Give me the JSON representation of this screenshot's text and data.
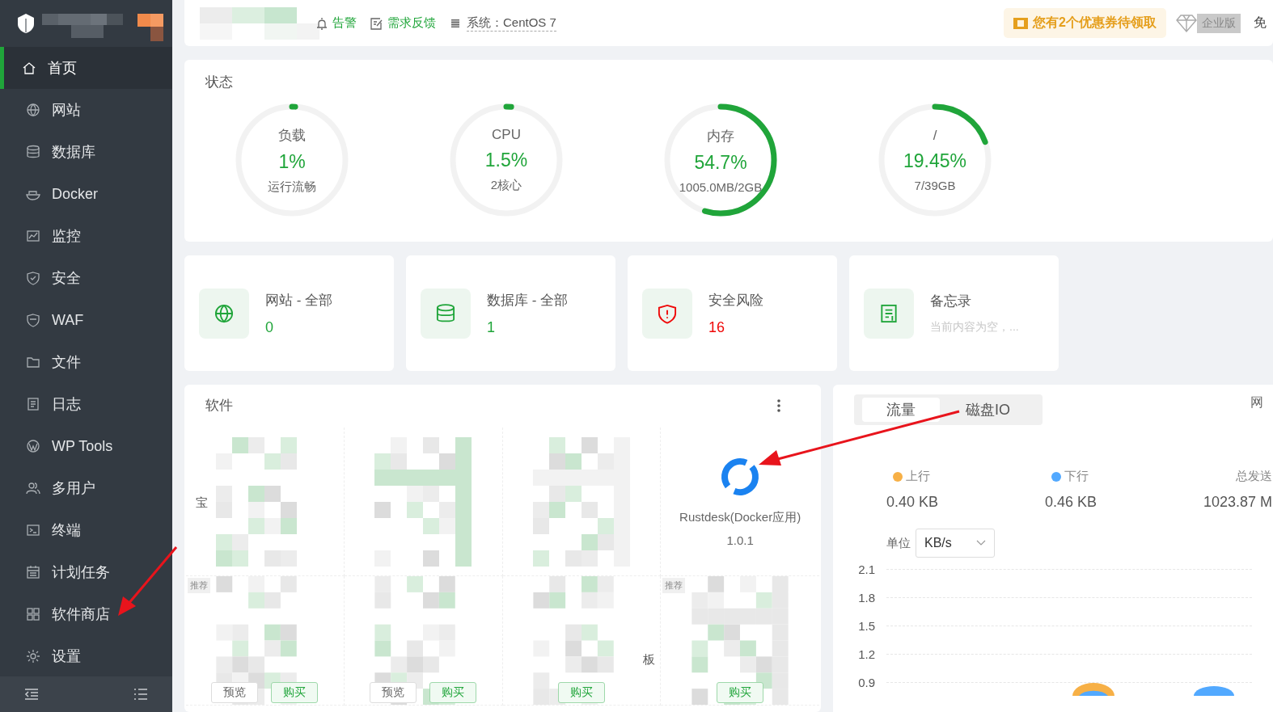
{
  "sidebar": {
    "items": [
      {
        "label": "首页",
        "selected": true
      },
      {
        "label": "网站",
        "selected": false
      },
      {
        "label": "数据库",
        "selected": false
      },
      {
        "label": "Docker",
        "selected": false
      },
      {
        "label": "监控",
        "selected": false
      },
      {
        "label": "安全",
        "selected": false
      },
      {
        "label": "WAF",
        "selected": false
      },
      {
        "label": "文件",
        "selected": false
      },
      {
        "label": "日志",
        "selected": false
      },
      {
        "label": "WP Tools",
        "selected": false
      },
      {
        "label": "多用户",
        "selected": false
      },
      {
        "label": "终端",
        "selected": false
      },
      {
        "label": "计划任务",
        "selected": false
      },
      {
        "label": "软件商店",
        "selected": false
      },
      {
        "label": "设置",
        "selected": false
      }
    ]
  },
  "topbar": {
    "links": [
      {
        "kind": "alert",
        "label": "告警"
      },
      {
        "kind": "feedback",
        "label": "需求反馈"
      },
      {
        "kind": "system",
        "label": "系统：CentOS 7"
      }
    ],
    "coupon": "您有2个优惠券待领取",
    "edition": "企业版",
    "trailing": "免"
  },
  "status": {
    "title": "状态",
    "gauges": [
      {
        "label": "负载",
        "value": "1%",
        "detail": "运行流畅",
        "level": 0.01
      },
      {
        "label": "CPU",
        "value": "1.5%",
        "detail": "2核心",
        "level": 0.015
      },
      {
        "label": "内存",
        "value": "54.7%",
        "detail": "1005.0MB/2GB",
        "level": 0.547
      },
      {
        "label": "/",
        "value": "19.45%",
        "detail": "7/39GB",
        "level": 0.1945
      }
    ]
  },
  "overview": [
    {
      "label": "网站 - 全部",
      "value": "0",
      "kind": "count"
    },
    {
      "label": "数据库 - 全部",
      "value": "1",
      "kind": "count"
    },
    {
      "label": "安全风险",
      "value": "16",
      "kind": "alert"
    },
    {
      "label": "备忘录",
      "value": "当前内容为空，...",
      "kind": "note"
    }
  ],
  "software": {
    "title": "软件",
    "items": [
      {
        "kind": "hidden",
        "fragment": "宝"
      },
      {
        "kind": "hidden"
      },
      {
        "kind": "hidden"
      },
      {
        "kind": "app",
        "name": "Rustdesk(Docker应用)",
        "version": "1.0.1"
      },
      {
        "kind": "hidden",
        "tag": "推荐",
        "buttons": [
          "预览",
          "购买"
        ]
      },
      {
        "kind": "hidden",
        "buttons": [
          "预览",
          "购买"
        ]
      },
      {
        "kind": "hidden",
        "fragment": "板",
        "buttons": [
          "购买"
        ]
      },
      {
        "kind": "hidden",
        "tag": "推荐",
        "buttons": [
          "购买"
        ]
      }
    ]
  },
  "traffic": {
    "tabs": [
      {
        "label": "流量",
        "selected": true
      },
      {
        "label": "磁盘IO",
        "selected": false
      }
    ],
    "trailing": "网",
    "stats": [
      {
        "label": "上行",
        "value": "0.40 KB",
        "color": "#f7b046"
      },
      {
        "label": "下行",
        "value": "0.46 KB",
        "color": "#52a9ff"
      },
      {
        "label": "总发送",
        "value": "1023.87 M"
      }
    ],
    "unit_label": "单位",
    "unit": "KB/s",
    "y_ticks": [
      "2.1",
      "1.8",
      "1.5",
      "1.2",
      "0.9"
    ]
  }
}
